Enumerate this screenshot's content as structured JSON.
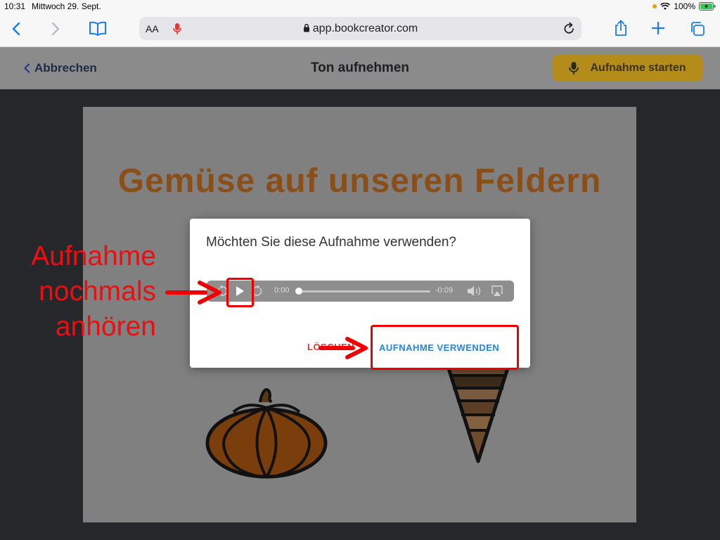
{
  "status": {
    "time": "10:31",
    "date": "Mittwoch 29. Sept.",
    "battery": "100%"
  },
  "browser": {
    "url": "app.bookcreator.com",
    "text_size_label": "AA"
  },
  "header": {
    "cancel_label": "Abbrechen",
    "title": "Ton aufnehmen",
    "record_label": "Aufnahme starten"
  },
  "book": {
    "title": "Gemüse auf unseren Feldern"
  },
  "dialog": {
    "question": "Möchten Sie diese Aufnahme verwenden?",
    "time_elapsed": "0:00",
    "time_remaining": "-0:09",
    "delete_label": "LÖSCHEN",
    "use_label": "AUFNAHME VERWENDEN"
  },
  "annotation": {
    "lines": [
      "Aufnahme",
      "nochmals",
      "anhören"
    ]
  },
  "colors": {
    "accent": "#2a85d6",
    "annotation": "#e81010",
    "record_button": "#f5bd1f",
    "title": "#c06c20"
  }
}
